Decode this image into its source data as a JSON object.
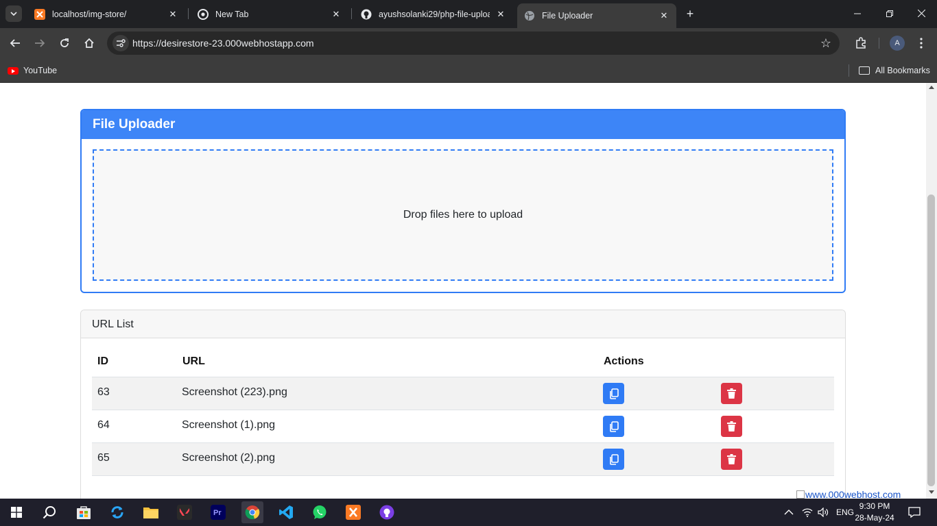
{
  "browser": {
    "tabs": [
      {
        "title": "localhost/img-store/",
        "icon": "xampp-icon"
      },
      {
        "title": "New Tab",
        "icon": "chrome-icon"
      },
      {
        "title": "ayushsolanki29/php-file-upload",
        "icon": "github-icon"
      },
      {
        "title": "File Uploader",
        "icon": "globe-icon",
        "active": true
      }
    ],
    "url": "https://desirestore-23.000webhostapp.com",
    "avatar_letter": "A",
    "bookmarks": {
      "youtube": "YouTube",
      "all_bookmarks": "All Bookmarks"
    }
  },
  "uploader": {
    "title": "File Uploader",
    "dropzone_text": "Drop files here to upload",
    "accent": "#2f7bf5"
  },
  "url_list": {
    "title": "URL List",
    "headers": {
      "id": "ID",
      "url": "URL",
      "actions": "Actions"
    },
    "rows": [
      {
        "id": "63",
        "url": "Screenshot (223).png"
      },
      {
        "id": "64",
        "url": "Screenshot (1).png"
      },
      {
        "id": "65",
        "url": "Screenshot (2).png"
      }
    ],
    "copy_color": "#2f7bf5",
    "delete_color": "#dc3545"
  },
  "host_badge": "www.000webhost.com",
  "taskbar": {
    "language": "ENG",
    "time": "9:30 PM",
    "date": "28-May-24"
  }
}
